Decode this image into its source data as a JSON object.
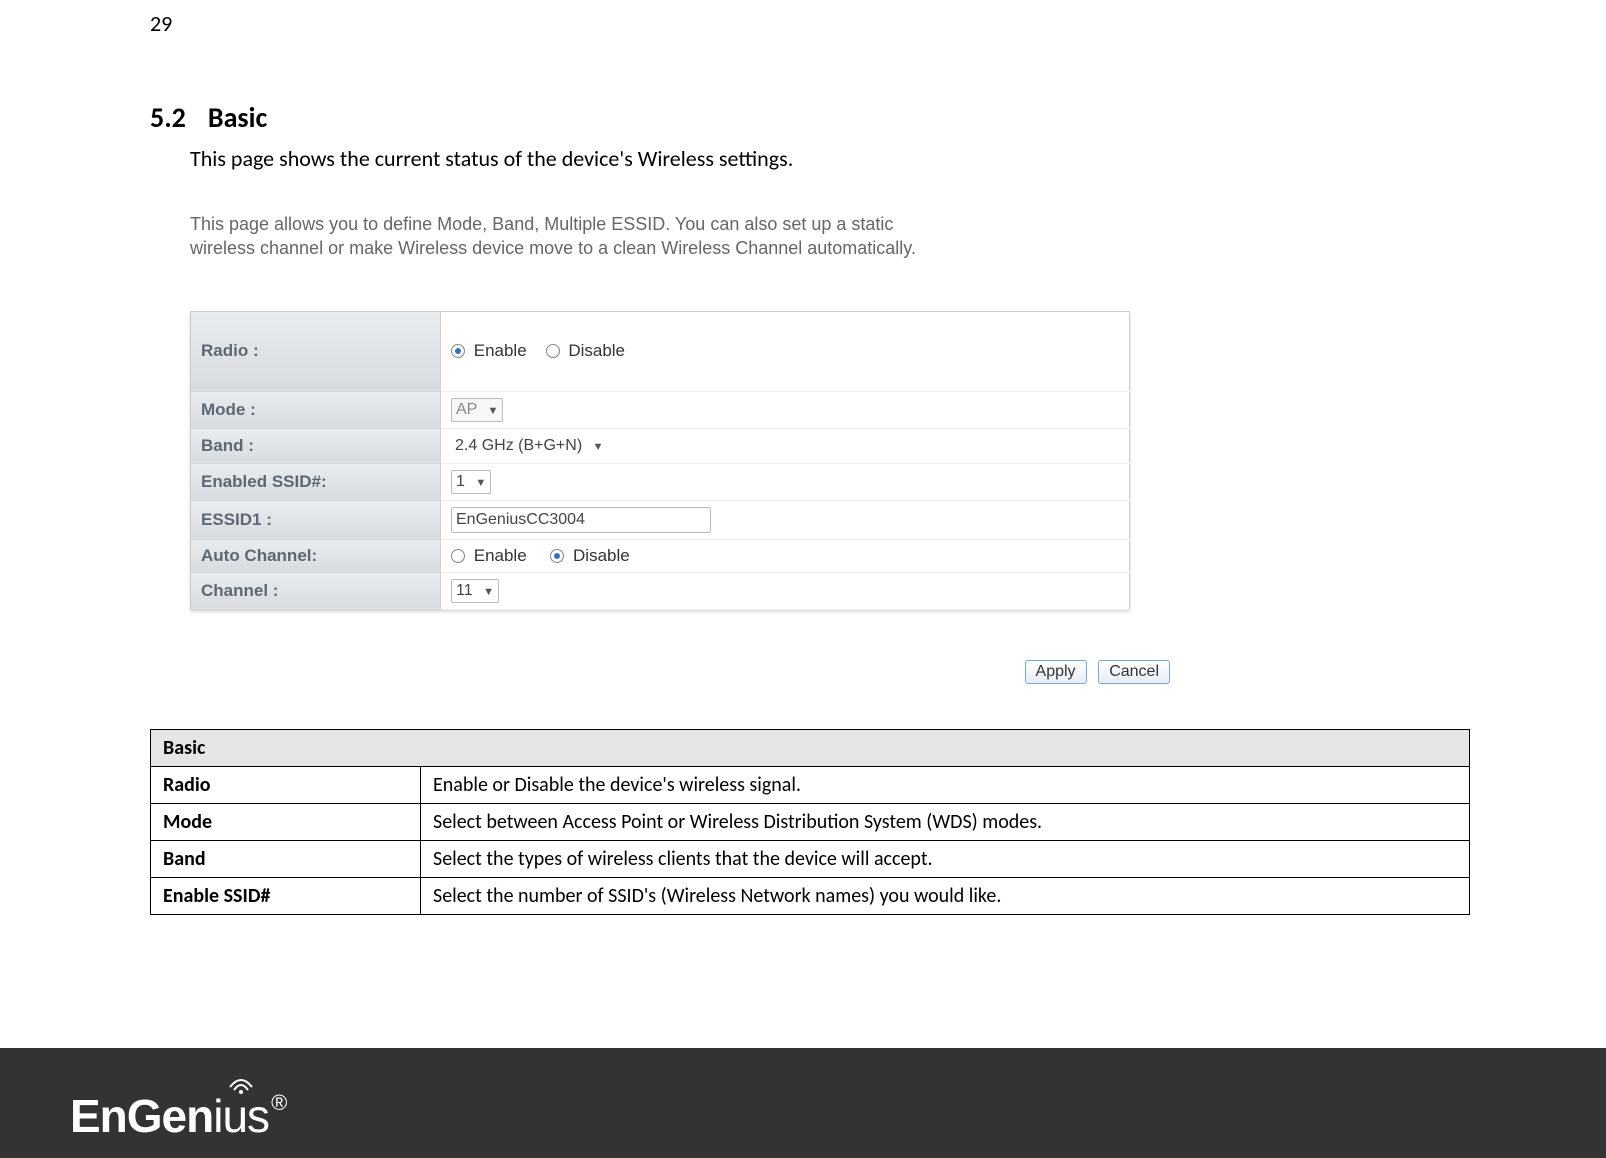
{
  "page_number": "29",
  "heading": {
    "num": "5.2",
    "title": "Basic"
  },
  "intro": "This page shows the current status of the device's Wireless settings.",
  "ui_desc_line1": "This page allows you to define Mode, Band, Multiple ESSID. You can also set up a static",
  "ui_desc_line2": "wireless channel or make Wireless device move to a clean Wireless Channel automatically.",
  "form": {
    "radio_label": "Radio :",
    "radio_enable": "Enable",
    "radio_disable": "Disable",
    "mode_label": "Mode :",
    "mode_value": "AP",
    "band_label": "Band :",
    "band_value": "2.4 GHz (B+G+N)",
    "enabled_ssid_label": "Enabled SSID#:",
    "enabled_ssid_value": "1",
    "essid1_label": "ESSID1 :",
    "essid1_value": "EnGeniusCC3004",
    "auto_channel_label": "Auto Channel:",
    "auto_enable": "Enable",
    "auto_disable": "Disable",
    "channel_label": "Channel :",
    "channel_value": "11"
  },
  "buttons": {
    "apply": "Apply",
    "cancel": "Cancel"
  },
  "desc": {
    "header": "Basic",
    "rows": [
      {
        "k": "Radio",
        "v": "Enable or Disable the device's wireless signal."
      },
      {
        "k": "Mode",
        "v": "Select between Access Point or Wireless Distribution System (WDS) modes."
      },
      {
        "k": "Band",
        "v": "Select the types of wireless clients that the device will accept."
      },
      {
        "k": "Enable SSID#",
        "v": "Select the number of SSID's (Wireless Network names) you would like."
      }
    ]
  },
  "logo": {
    "part1": "En",
    "part2": "Gen",
    "part3": "ius",
    "reg": "®"
  }
}
